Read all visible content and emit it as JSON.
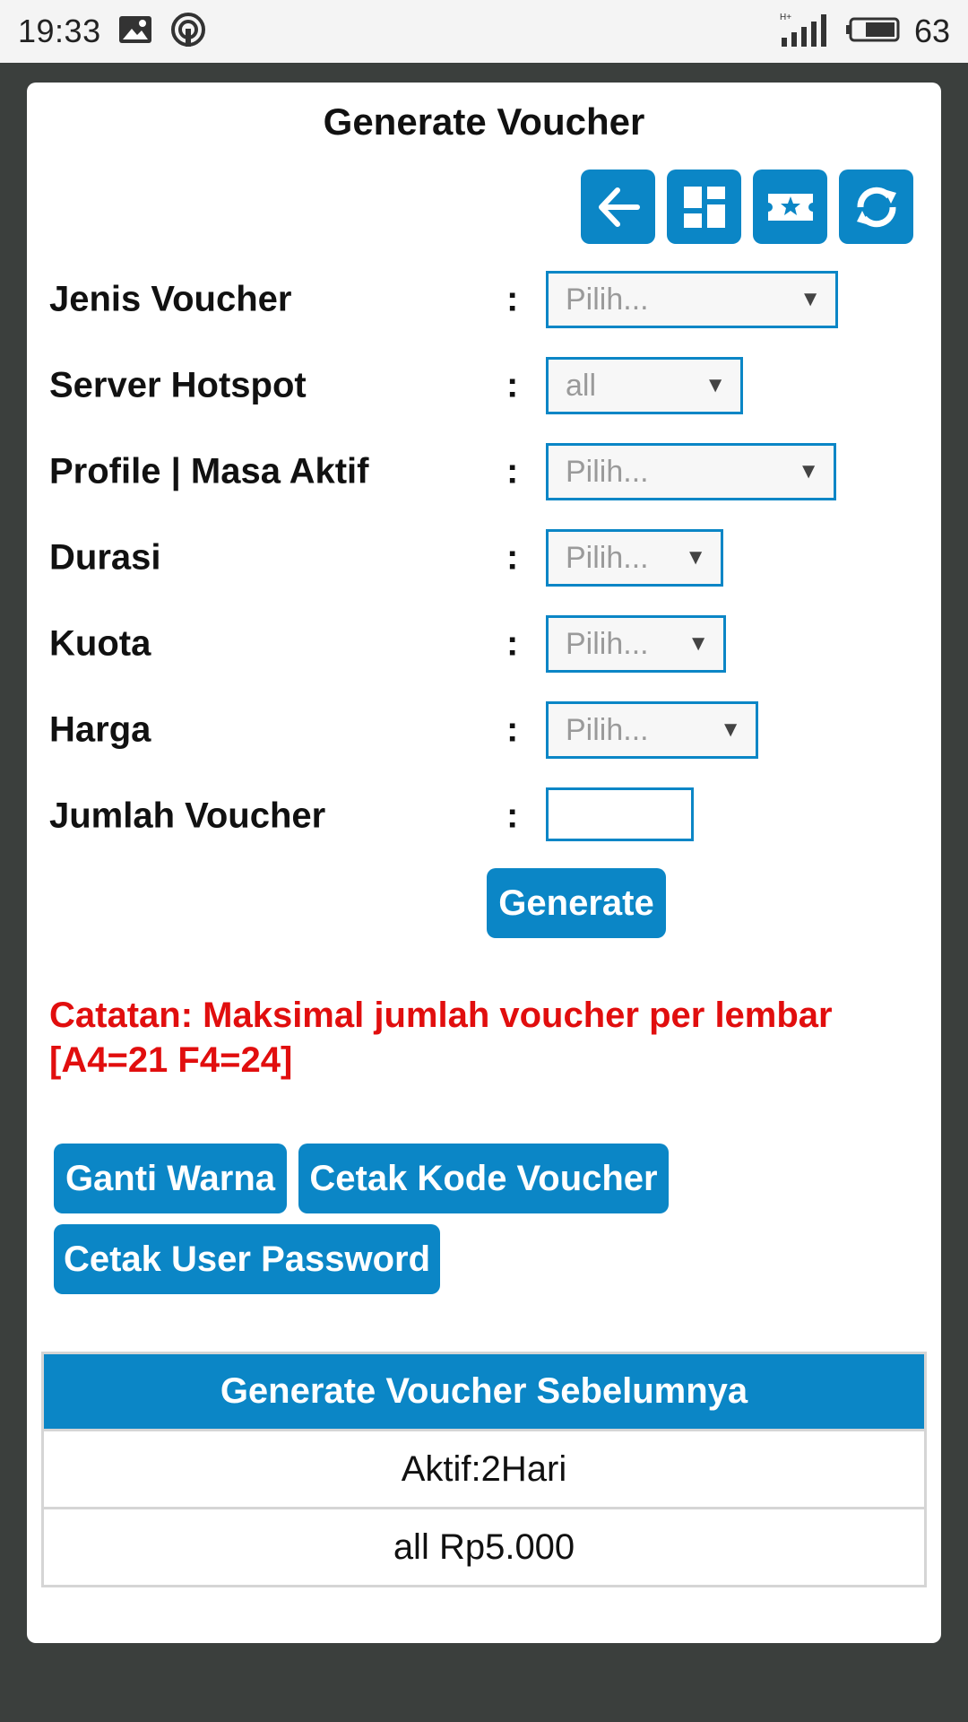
{
  "status_bar": {
    "time": "19:33",
    "battery": "63",
    "network_type": "H+"
  },
  "page": {
    "title": "Generate Voucher"
  },
  "toolbar": {
    "icons": [
      "arrow-left-icon",
      "dashboard-icon",
      "ticket-star-icon",
      "refresh-icon"
    ]
  },
  "form": {
    "fields": [
      {
        "label": "Jenis Voucher",
        "colon": ":",
        "value": "Pilih..."
      },
      {
        "label": "Server Hotspot",
        "colon": ":",
        "value": "all"
      },
      {
        "label": "Profile | Masa Aktif",
        "colon": ":",
        "value": "Pilih..."
      },
      {
        "label": "Durasi",
        "colon": ":",
        "value": "Pilih..."
      },
      {
        "label": "Kuota",
        "colon": ":",
        "value": "Pilih..."
      },
      {
        "label": "Harga",
        "colon": ":",
        "value": "Pilih..."
      },
      {
        "label": "Jumlah Voucher",
        "colon": ":",
        "value": ""
      }
    ],
    "generate_label": "Generate"
  },
  "note": {
    "line1": "Catatan: Maksimal jumlah voucher per lembar",
    "line2": "[A4=21 F4=24]"
  },
  "actions": {
    "ganti_warna": "Ganti Warna",
    "cetak_kode": "Cetak Kode Voucher",
    "cetak_user": "Cetak User Password"
  },
  "history": {
    "header": "Generate Voucher Sebelumnya",
    "rows": [
      "Aktif:2Hari",
      "all Rp5.000"
    ]
  },
  "colors": {
    "accent": "#0b86c6",
    "note": "#e10e0e",
    "background": "#3b3f3d"
  }
}
